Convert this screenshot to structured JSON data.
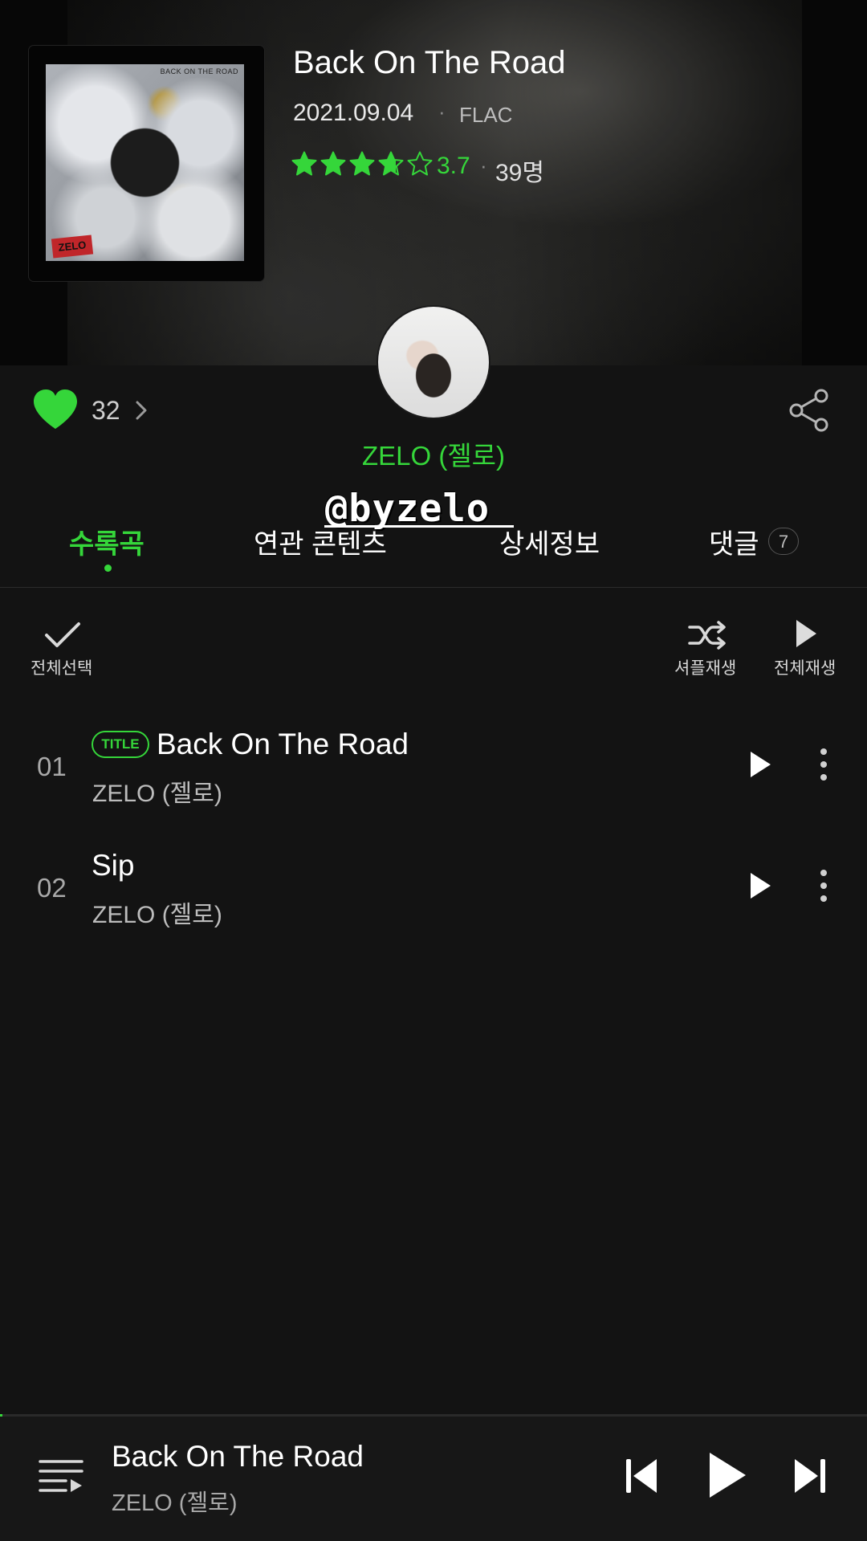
{
  "album": {
    "title": "Back On The Road",
    "date": "2021.09.04",
    "separator": "·",
    "format": "FLAC",
    "rating_value": 3.7,
    "rating_text": "3.7",
    "rating_count": "39명",
    "art_text": "BACK ON THE ROAD",
    "art_logo": "ZELO"
  },
  "artist": {
    "name": "ZELO (젤로)"
  },
  "likes": {
    "count": "32"
  },
  "watermark": "@byzelo",
  "tabs": [
    {
      "label": "수록곡",
      "active": true
    },
    {
      "label": "연관 콘텐츠",
      "active": false
    },
    {
      "label": "상세정보",
      "active": false
    },
    {
      "label": "댓글",
      "active": false,
      "badge": "7"
    }
  ],
  "toolbar": {
    "select_all": "전체선택",
    "shuffle": "셔플재생",
    "play_all": "전체재생"
  },
  "tracks": [
    {
      "number": "01",
      "badge": "TITLE",
      "title": "Back On The Road",
      "artist": "ZELO (젤로)"
    },
    {
      "number": "02",
      "badge": "",
      "title": "Sip",
      "artist": "ZELO (젤로)"
    }
  ],
  "player": {
    "title": "Back On The Road",
    "artist": "ZELO (젤로)",
    "progress": 0.003
  },
  "colors": {
    "accent": "#35d63a",
    "background": "#131313",
    "text": "#ffffff",
    "muted": "#a9a9a9"
  },
  "icons": {
    "like": "heart-icon",
    "share": "share-icon",
    "select_all": "check-icon",
    "shuffle": "shuffle-icon",
    "play_all": "play-icon",
    "track_play": "play-icon",
    "track_more": "more-vertical-icon",
    "playlist": "playlist-icon",
    "previous": "skip-previous-icon",
    "next": "skip-next-icon"
  }
}
